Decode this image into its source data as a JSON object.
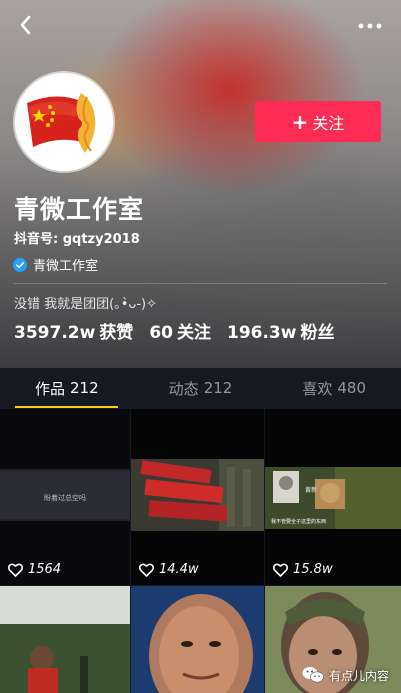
{
  "profile": {
    "name": "青微工作室",
    "handle": "抖音号: gqtzy2018",
    "verified_label": "青微工作室",
    "bio": "没错 我就是团团(｡•̀ᴗ-)✧",
    "follow_label": "关注"
  },
  "stats": [
    {
      "value": "3597.2w",
      "label": "获赞"
    },
    {
      "value": "60",
      "label": "关注"
    },
    {
      "value": "196.3w",
      "label": "粉丝"
    }
  ],
  "tabs": [
    {
      "label": "作品",
      "count": "212"
    },
    {
      "label": "动态",
      "count": "212"
    },
    {
      "label": "喜欢",
      "count": "480"
    }
  ],
  "videos": [
    {
      "likes": "1564",
      "caption": "盼着过总空吗"
    },
    {
      "likes": "14.4w",
      "caption": ""
    },
    {
      "likes": "15.8w",
      "caption": "黄新",
      "subcaption": "我不管要全子这里的东西"
    }
  ],
  "watermark": "有点儿内容",
  "colors": {
    "accent": "#fe2c55",
    "tab_indicator": "#face15",
    "background": "#161823"
  }
}
